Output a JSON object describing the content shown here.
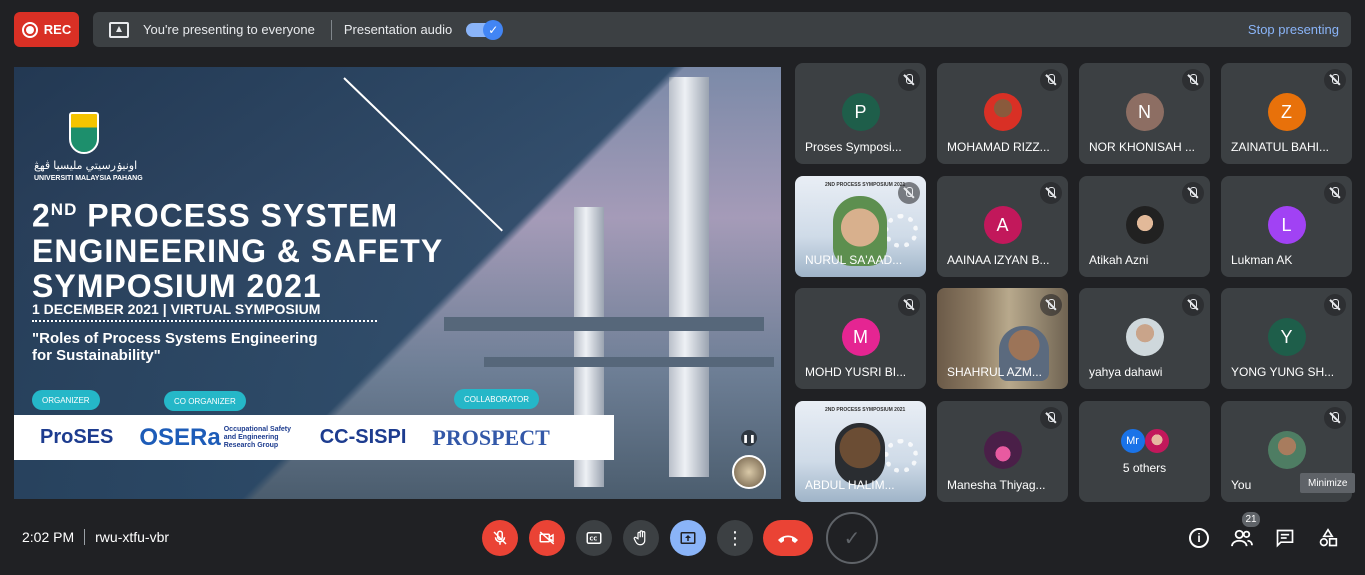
{
  "topbar": {
    "rec_label": "REC",
    "presenting_text": "You're presenting to everyone",
    "audio_label": "Presentation audio",
    "audio_on": true,
    "stop_label": "Stop presenting"
  },
  "slide": {
    "arabic_text": "اونيۏرسيتي مليسيا ڤهڠ",
    "university": "UNIVERSITI MALAYSIA PAHANG",
    "title_prefix": "2",
    "title_sup": "ND",
    "title_line1": " PROCESS SYSTEM",
    "title_line2": "ENGINEERING & SAFETY",
    "title_line3": "SYMPOSIUM 2021",
    "date_line": "1 DECEMBER 2021 | VIRTUAL SYMPOSIUM",
    "quote_line1": "\"Roles of Process Systems Engineering",
    "quote_line2": "for Sustainability\"",
    "organizer": "ORGANIZER",
    "co_organizer": "CO ORGANIZER",
    "collaborator": "COLLABORATOR",
    "sponsors": {
      "proses": "ProSES",
      "osera": "OSERa",
      "osera_sub": "Occupational Safety and Engineering Research Group",
      "ccsispi": "CC-SISPI",
      "prospect": "PROSPECT"
    }
  },
  "participants": [
    {
      "name": "Proses Symposi...",
      "initial": "P",
      "color": "#1e5e4a"
    },
    {
      "name": "MOHAMAD RIZZ...",
      "initial": "",
      "color": "#c9d6e3"
    },
    {
      "name": "NOR KHONISAH ...",
      "initial": "N",
      "color": "#8d6e63"
    },
    {
      "name": "ZAINATUL BAHI...",
      "initial": "Z",
      "color": "#e8710a"
    },
    {
      "name": "NURUL SA'AAD...",
      "initial": "",
      "color": ""
    },
    {
      "name": "AAINAA IZYAN B...",
      "initial": "A",
      "color": "#c2185b"
    },
    {
      "name": "Atikah Azni",
      "initial": "",
      "color": "#d7ccc8"
    },
    {
      "name": "Lukman AK",
      "initial": "L",
      "color": "#a142f4"
    },
    {
      "name": "MOHD YUSRI BI...",
      "initial": "M",
      "color": "#e52592"
    },
    {
      "name": "SHAHRUL AZM...",
      "initial": "",
      "color": ""
    },
    {
      "name": "yahya dahawi",
      "initial": "",
      "color": "#cfd8dc"
    },
    {
      "name": "YONG YUNG SH...",
      "initial": "Y",
      "color": "#1e5e4a"
    },
    {
      "name": "ABDUL HALIM...",
      "initial": "",
      "color": ""
    },
    {
      "name": "Manesha Thiyag...",
      "initial": "",
      "color": "#7b3f6e"
    },
    {
      "name": "5 others",
      "initial": "Mr",
      "color": "#1a73e8"
    },
    {
      "name": "You",
      "initial": "",
      "color": "#4e7d63"
    }
  ],
  "mini_slide_title": "2ND PROCESS SYMPOSIUM 2021",
  "minimize_tooltip": "Minimize",
  "bottombar": {
    "time": "2:02 PM",
    "meeting_code": "rwu-xtfu-vbr",
    "people_count": "21"
  },
  "colors": {
    "background": "#202124",
    "tile": "#3c4043",
    "danger": "#ea4335",
    "accent": "#8ab4f8"
  }
}
